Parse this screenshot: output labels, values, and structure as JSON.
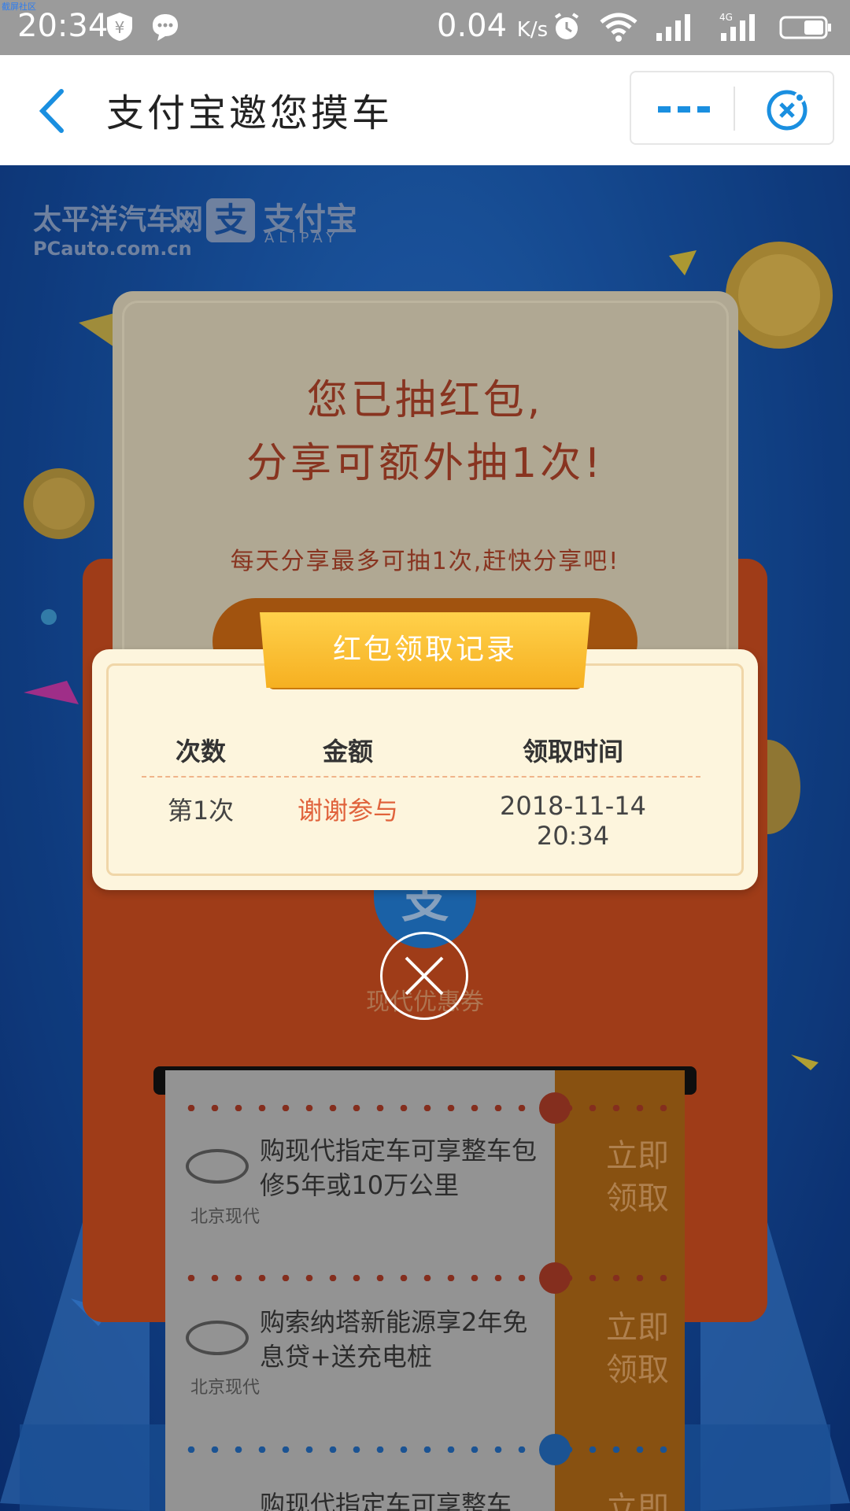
{
  "status_bar": {
    "corner_tag": "截屏社区",
    "time": "20:34",
    "speed_value": "0.04",
    "speed_unit": "K/s",
    "network": "4G",
    "icons": [
      "shield-yen-icon",
      "chat-bubble-icon",
      "alarm-icon",
      "wifi-icon",
      "signal-icon",
      "signal-4g-icon",
      "battery-icon"
    ]
  },
  "title_bar": {
    "title": "支付宝邀您摸车",
    "back_icon": "chevron-left-icon",
    "more_icon": "more-dots-icon",
    "close_icon": "mini-close-icon"
  },
  "background": {
    "partner_logo_cn": "太平洋汽车网",
    "partner_logo_url": "PCauto.com.cn",
    "times": "×",
    "alipay_mark": "支",
    "alipay_cn": "支付宝",
    "alipay_en": "ALIPAY",
    "message_line1": "您已抽红包,",
    "message_line2": "分享可额外抽1次!",
    "message_sub": "每天分享最多可抽1次,赶快分享吧!",
    "coupon_label": "现代优惠券",
    "coupons": [
      {
        "title": "购现代指定车可享整车包修5年或10万公里",
        "brand": "北京现代",
        "action_line1": "立即",
        "action_line2": "领取"
      },
      {
        "title": "购索纳塔新能源享2年免息贷+送充电桩",
        "brand": "北京现代",
        "action_line1": "立即",
        "action_line2": "领取"
      },
      {
        "title": "购现代指定车可享整车",
        "brand": "",
        "action_line1": "立即",
        "action_line2": ""
      }
    ]
  },
  "modal": {
    "ribbon_title": "红包领取记录",
    "columns": [
      "次数",
      "金额",
      "领取时间"
    ],
    "rows": [
      {
        "count": "第1次",
        "amount": "谢谢参与",
        "time": "2018-11-14 20:34"
      }
    ],
    "close_icon": "close-circle-icon"
  },
  "colors": {
    "accent_blue": "#1a8fe0",
    "ribbon_yellow": "#f6b021",
    "amount_red": "#e0623b",
    "modal_bg": "#fdf5dd"
  }
}
